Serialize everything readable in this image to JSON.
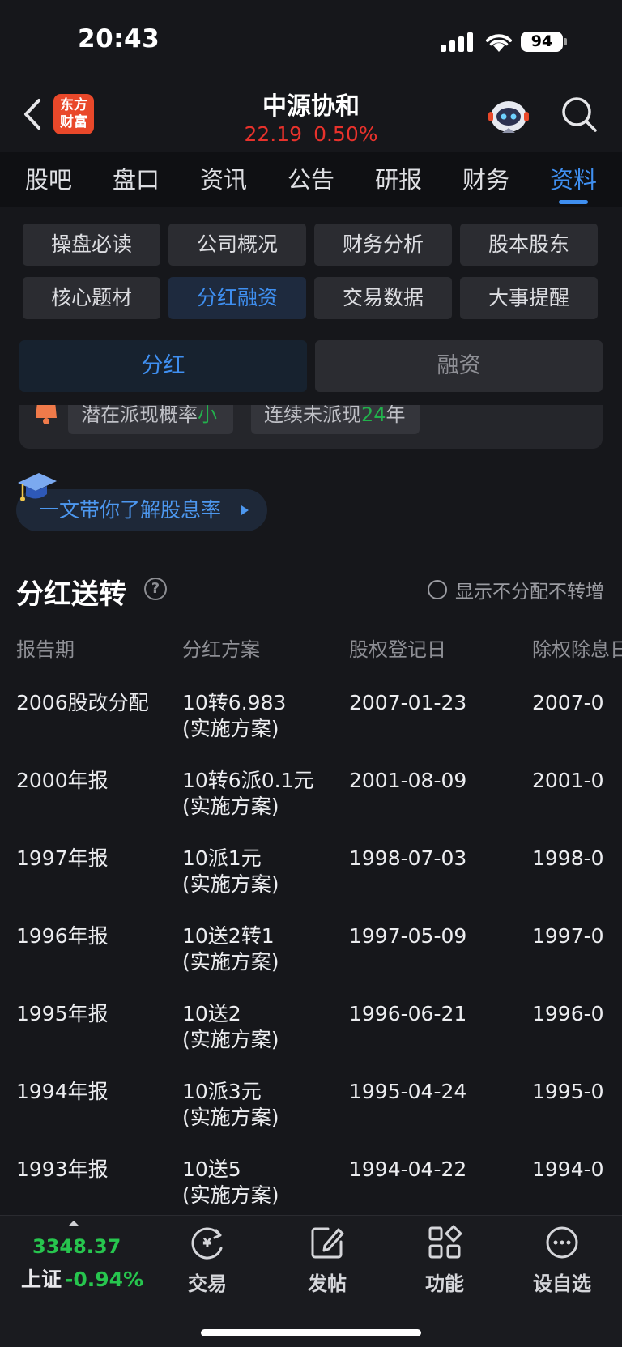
{
  "status_bar": {
    "time": "20:43",
    "battery": "94"
  },
  "header": {
    "logo_line1": "东方",
    "logo_line2": "财富",
    "stock_name": "中源协和",
    "price": "22.19",
    "change": "0.50%",
    "price_color": "#e8322c"
  },
  "top_tabs": [
    "股吧",
    "盘口",
    "资讯",
    "公告",
    "研报",
    "财务",
    "资料"
  ],
  "active_top_tab": "资料",
  "chips": [
    "操盘必读",
    "公司概况",
    "财务分析",
    "股本股东",
    "核心题材",
    "分红融资",
    "交易数据",
    "大事提醒"
  ],
  "active_chip": "分红融资",
  "segment": {
    "left": "分红",
    "right": "融资"
  },
  "stats": {
    "pill1_prefix": "潜在派现概率",
    "pill1_value": "小",
    "pill2_prefix": "连续未派现",
    "pill2_value": "24",
    "pill2_suffix": "年"
  },
  "learn_banner": "一文带你了解股息率",
  "section": {
    "title": "分红送转",
    "help": "?",
    "toggle_label": "显示不分配不转增"
  },
  "table": {
    "headers": [
      "报告期",
      "分红方案",
      "股权登记日",
      "除权除息日"
    ],
    "rows": [
      {
        "period": "2006股改分配",
        "plan": "10转6.983",
        "plan_status": "(实施方案)",
        "record_date": "2007-01-23",
        "ex_date": "2007-0"
      },
      {
        "period": "2000年报",
        "plan": "10转6派0.1元",
        "plan_status": "(实施方案)",
        "record_date": "2001-08-09",
        "ex_date": "2001-0"
      },
      {
        "period": "1997年报",
        "plan": "10派1元",
        "plan_status": "(实施方案)",
        "record_date": "1998-07-03",
        "ex_date": "1998-0"
      },
      {
        "period": "1996年报",
        "plan": "10送2转1",
        "plan_status": "(实施方案)",
        "record_date": "1997-05-09",
        "ex_date": "1997-0"
      },
      {
        "period": "1995年报",
        "plan": "10送2",
        "plan_status": "(实施方案)",
        "record_date": "1996-06-21",
        "ex_date": "1996-0"
      },
      {
        "period": "1994年报",
        "plan": "10派3元",
        "plan_status": "(实施方案)",
        "record_date": "1995-04-24",
        "ex_date": "1995-0"
      },
      {
        "period": "1993年报",
        "plan": "10送5",
        "plan_status": "(实施方案)",
        "record_date": "1994-04-22",
        "ex_date": "1994-0"
      }
    ]
  },
  "bottom_bar": {
    "index_value": "3348.37",
    "index_name": "上证",
    "index_change": "-0.94%",
    "nav": [
      {
        "label": "交易",
        "icon": "yen-cycle-icon"
      },
      {
        "label": "发帖",
        "icon": "edit-icon"
      },
      {
        "label": "功能",
        "icon": "grid-icon"
      },
      {
        "label": "设自选",
        "icon": "more-icon"
      }
    ]
  },
  "colors": {
    "accent": "#3f8ff0",
    "rise": "#e8322c",
    "fall": "#27c54e",
    "background": "#16171b"
  }
}
